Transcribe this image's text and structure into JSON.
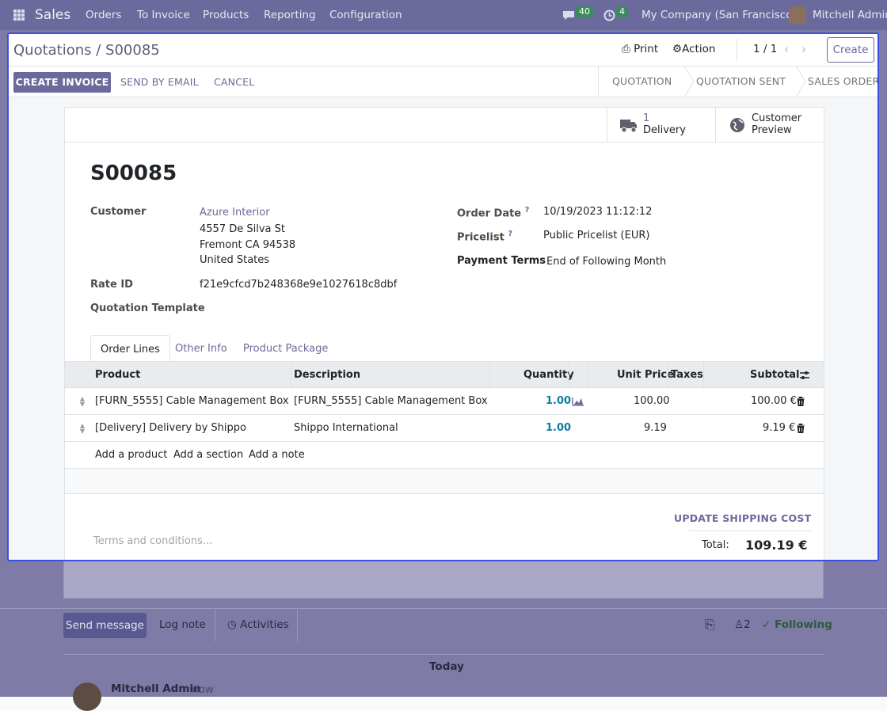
{
  "navbar": {
    "app": "Sales",
    "menu": [
      "Orders",
      "To Invoice",
      "Products",
      "Reporting",
      "Configuration"
    ],
    "messages_count": "40",
    "activities_count": "4",
    "company": "My Company (San Francisco)",
    "user": "Mitchell Admin"
  },
  "dialog": {
    "breadcrumb": "Quotations / S00085",
    "print": "Print",
    "action": "Action",
    "pager": "1 / 1",
    "create": "Create",
    "buttons": {
      "create_invoice": "CREATE INVOICE",
      "send_by_email": "SEND BY EMAIL",
      "cancel": "CANCEL"
    },
    "stages": [
      "QUOTATION",
      "QUOTATION SENT",
      "SALES ORDER"
    ],
    "smart_buttons": {
      "delivery_count": "1",
      "delivery_label": "Delivery",
      "preview_line1": "Customer",
      "preview_line2": "Preview"
    },
    "order": {
      "name": "S00085",
      "customer_label": "Customer",
      "customer_name": "Azure Interior",
      "address": [
        "4557 De Silva St",
        "Fremont CA 94538",
        "United States"
      ],
      "rate_id_label": "Rate ID",
      "rate_id": "f21e9cfcd7b248368e9e1027618c8dbf",
      "template_label": "Quotation Template",
      "order_date_label": "Order Date",
      "order_date": "10/19/2023 11:12:12",
      "pricelist_label": "Pricelist",
      "pricelist": "Public Pricelist (EUR)",
      "payment_terms_label": "Payment Terms",
      "payment_terms": "End of Following Month",
      "help_mark": "?"
    },
    "tabs": [
      "Order Lines",
      "Other Info",
      "Product Package"
    ],
    "table": {
      "headers": {
        "product": "Product",
        "description": "Description",
        "quantity": "Quantity",
        "unit_price": "Unit Price",
        "taxes": "Taxes",
        "subtotal": "Subtotal"
      },
      "rows": [
        {
          "product": "[FURN_5555] Cable Management Box",
          "description": "[FURN_5555] Cable Management Box",
          "quantity": "1.00",
          "unit_price": "100.00",
          "taxes": "",
          "subtotal": "100.00 €"
        },
        {
          "product": "[Delivery] Delivery by Shippo",
          "description": "Shippo International",
          "quantity": "1.00",
          "unit_price": "9.19",
          "taxes": "",
          "subtotal": "9.19 €"
        }
      ],
      "add_product": "Add a product",
      "add_section": "Add a section",
      "add_note": "Add a note"
    },
    "footer": {
      "update_shipping": "UPDATE SHIPPING COST",
      "terms_placeholder": "Terms and conditions...",
      "total_label": "Total:",
      "total_value": "109.19 €"
    }
  },
  "chatter": {
    "send_message": "Send message",
    "log_note": "Log note",
    "activities": "Activities",
    "followers_count": "2",
    "following": "Following",
    "today": "Today",
    "author": "Mitchell Admin",
    "time": "- now"
  },
  "colors": {
    "brand": "#6b6a9c",
    "focus_border": "#3b50e0",
    "quantity": "#0b7ea3"
  }
}
